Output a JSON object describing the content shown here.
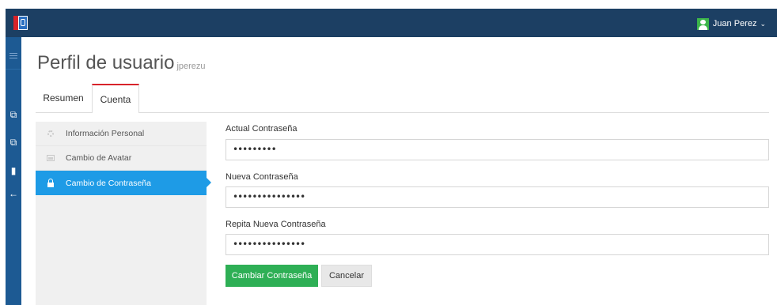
{
  "header": {
    "user_name": "Juan Perez",
    "user_chevron": "⌄"
  },
  "sidebar": {
    "icons": [
      "menu-icon",
      "copy-icon",
      "copy-icon",
      "document-icon",
      "arrow-left-icon"
    ]
  },
  "page": {
    "title": "Perfil de usuario",
    "username": "jperezu"
  },
  "tabs": [
    {
      "label": "Resumen"
    },
    {
      "label": "Cuenta"
    }
  ],
  "menu": {
    "items": [
      {
        "label": "Información Personal",
        "icon": "gear-icon"
      },
      {
        "label": "Cambio de Avatar",
        "icon": "image-icon"
      },
      {
        "label": "Cambio de Contraseña",
        "icon": "lock-icon"
      }
    ]
  },
  "form": {
    "current_password_label": "Actual Contraseña",
    "current_password_value": "•••••••••",
    "new_password_label": "Nueva Contraseña",
    "new_password_value": "•••••••••••••••",
    "repeat_password_label": "Repita Nueva Contraseña",
    "repeat_password_value": "•••••••••••••••",
    "submit_label": "Cambiar Contraseña",
    "cancel_label": "Cancelar"
  },
  "colors": {
    "topbar": "#1c3f63",
    "sidebar": "#1d5a93",
    "active_menu": "#1e9be6",
    "primary_button": "#2eaf55",
    "tab_accent": "#d8232a"
  }
}
